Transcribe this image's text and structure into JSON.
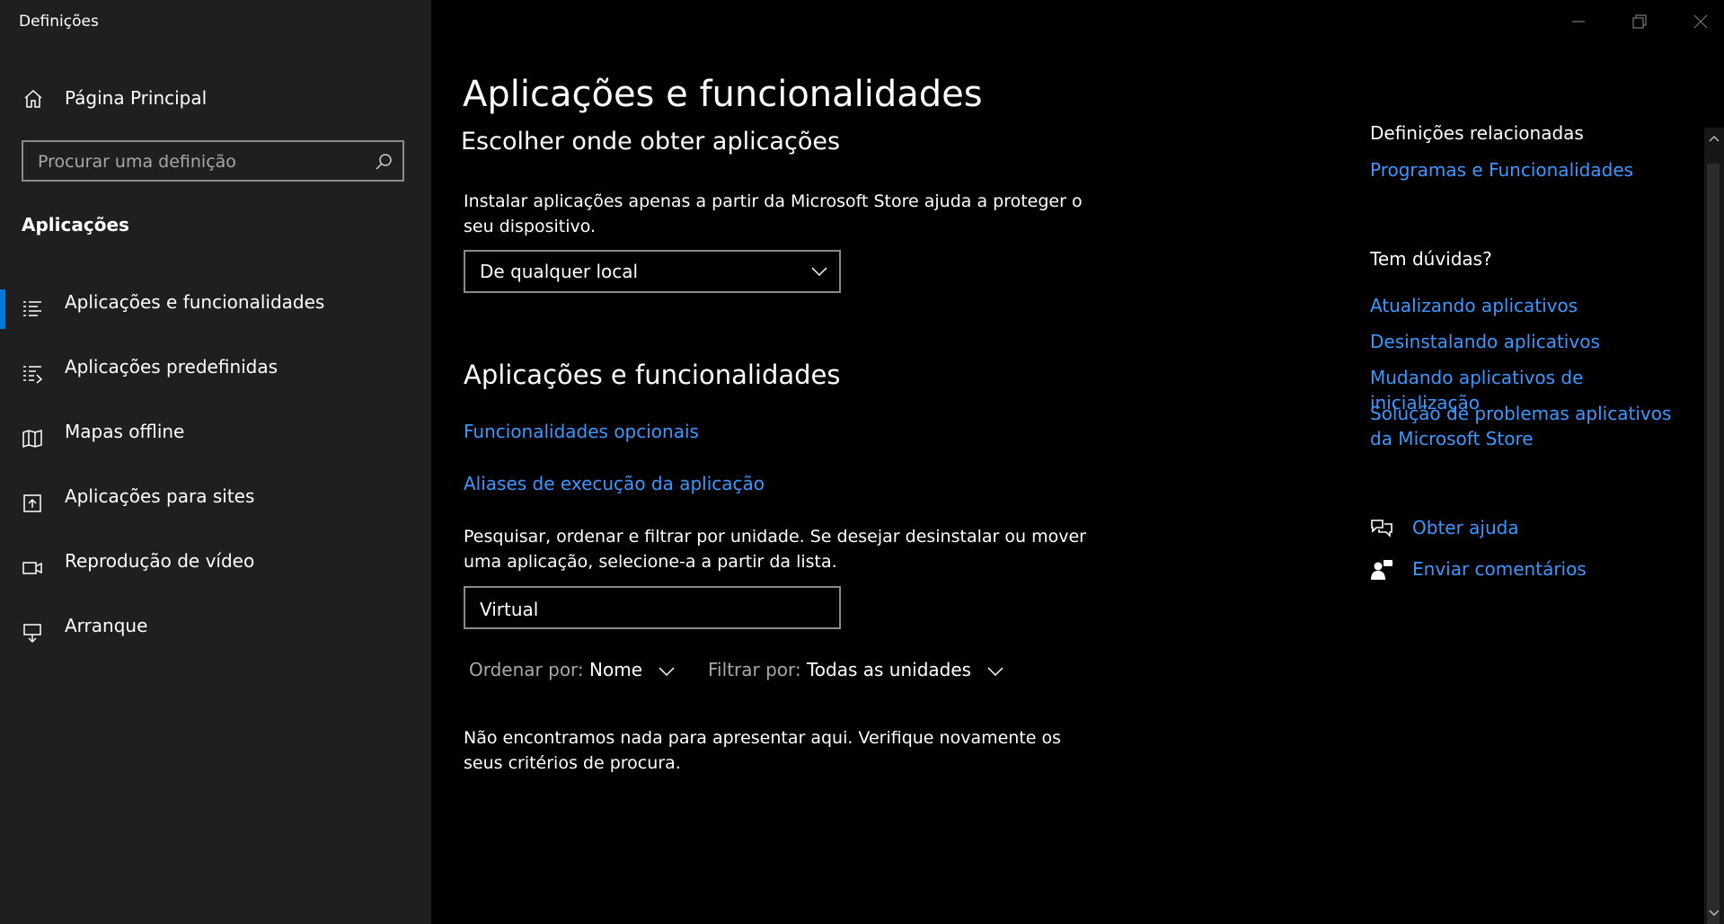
{
  "window": {
    "title": "Definições"
  },
  "sidebar": {
    "home_label": "Página Principal",
    "search_placeholder": "Procurar uma definição",
    "section_label": "Aplicações",
    "items": [
      {
        "label": "Aplicações e funcionalidades",
        "icon": "apps-list-icon",
        "selected": true
      },
      {
        "label": "Aplicações predefinidas",
        "icon": "default-apps-icon",
        "selected": false
      },
      {
        "label": "Mapas offline",
        "icon": "map-icon",
        "selected": false
      },
      {
        "label": "Aplicações para sites",
        "icon": "apps-websites-icon",
        "selected": false
      },
      {
        "label": "Reprodução de vídeo",
        "icon": "video-icon",
        "selected": false
      },
      {
        "label": "Arranque",
        "icon": "startup-icon",
        "selected": false
      }
    ]
  },
  "main": {
    "title": "Aplicações e funcionalidades",
    "choose_heading": "Escolher onde obter aplicações",
    "install_text": "Instalar aplicações apenas a partir da Microsoft Store ajuda a proteger o seu dispositivo.",
    "source_dropdown_value": "De qualquer local",
    "apps_heading": "Aplicações e funcionalidades",
    "optional_features_link": "Funcionalidades opcionais",
    "aliases_link": "Aliases de execução da aplicação",
    "search_text": "Pesquisar, ordenar e filtrar por unidade. Se desejar desinstalar ou mover uma aplicação, selecione-a a partir da lista.",
    "search_value": "Virtual",
    "sort_label": "Ordenar por:",
    "sort_value": "Nome",
    "filter_label": "Filtrar por:",
    "filter_value": "Todas as unidades",
    "empty_text": "Não encontramos nada para apresentar aqui. Verifique novamente os seus critérios de procura."
  },
  "related": {
    "title": "Definições relacionadas",
    "programs_link": "Programas e Funcionalidades"
  },
  "questions": {
    "title": "Tem dúvidas?",
    "links": [
      "Atualizando aplicativos",
      "Desinstalando aplicativos",
      "Mudando aplicativos de inicialização",
      "Solução de problemas aplicativos da Microsoft Store"
    ]
  },
  "help": {
    "get_help": "Obter ajuda",
    "feedback": "Enviar comentários"
  },
  "colors": {
    "accent": "#0078d7",
    "link": "#3d97ff",
    "sidebar_bg": "#1f1f1f",
    "main_bg": "#000000"
  }
}
